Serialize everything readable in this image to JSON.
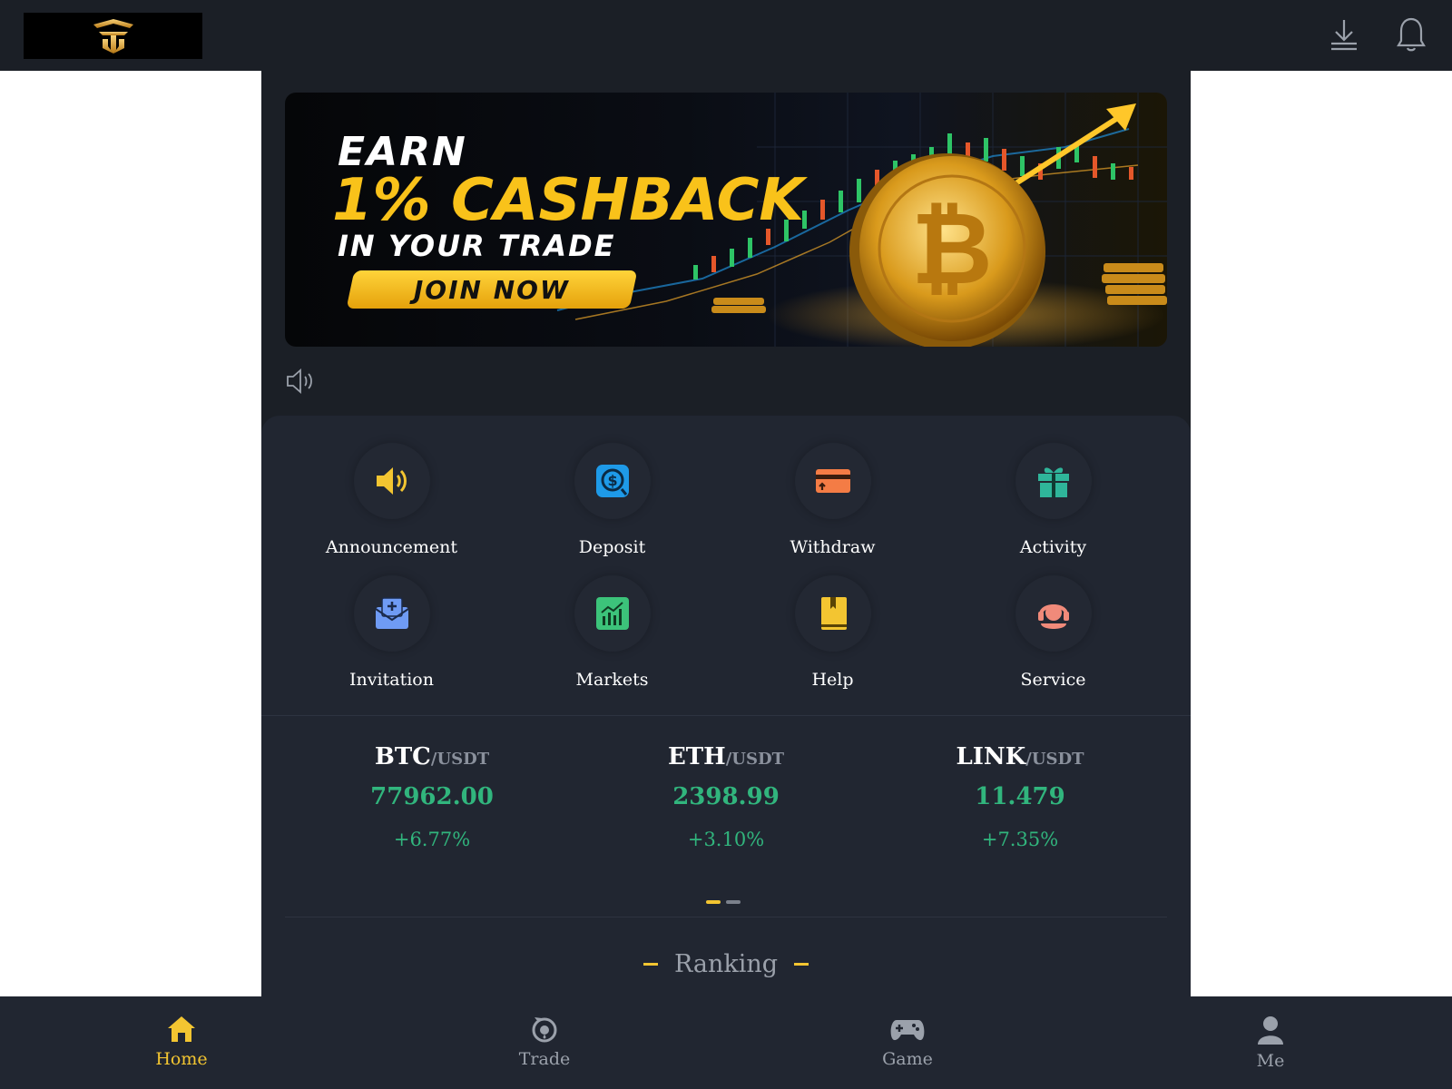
{
  "topbar": {
    "logo_alt": "logo",
    "download_icon": "download-icon",
    "bell_icon": "bell-icon"
  },
  "banner": {
    "line1": "EARN",
    "line2": "1% CASHBACK",
    "line3": "IN YOUR TRADE",
    "cta": "JOIN NOW"
  },
  "notice": {
    "icon": "speaker-outline-icon"
  },
  "quick_menu": [
    {
      "label": "Announcement",
      "icon": "megaphone-icon",
      "color": "#f3c531"
    },
    {
      "label": "Deposit",
      "icon": "deposit-icon",
      "color": "#1e9ae8"
    },
    {
      "label": "Withdraw",
      "icon": "card-icon",
      "color": "#f47c45"
    },
    {
      "label": "Activity",
      "icon": "gift-icon",
      "color": "#2fb59a"
    },
    {
      "label": "Invitation",
      "icon": "envelope-icon",
      "color": "#6f9bf4"
    },
    {
      "label": "Markets",
      "icon": "chart-icon",
      "color": "#3cc37a"
    },
    {
      "label": "Help",
      "icon": "book-icon",
      "color": "#f3c531"
    },
    {
      "label": "Service",
      "icon": "headset-icon",
      "color": "#f08a7a"
    }
  ],
  "tickers": [
    {
      "base": "BTC",
      "quote": "/USDT",
      "price": "77962.00",
      "change": "+6.77%"
    },
    {
      "base": "ETH",
      "quote": "/USDT",
      "price": "2398.99",
      "change": "+3.10%"
    },
    {
      "base": "LINK",
      "quote": "/USDT",
      "price": "11.479",
      "change": "+7.35%"
    }
  ],
  "ranking": {
    "title": "Ranking"
  },
  "bottom_nav": [
    {
      "label": "Home",
      "icon": "home-icon",
      "active": true
    },
    {
      "label": "Trade",
      "icon": "trade-icon",
      "active": false
    },
    {
      "label": "Game",
      "icon": "gamepad-icon",
      "active": false
    },
    {
      "label": "Me",
      "icon": "user-icon",
      "active": false
    }
  ],
  "colors": {
    "accent": "#f3c531",
    "up": "#31b57d",
    "bg_dark": "#1b1f26",
    "panel": "#212631"
  }
}
